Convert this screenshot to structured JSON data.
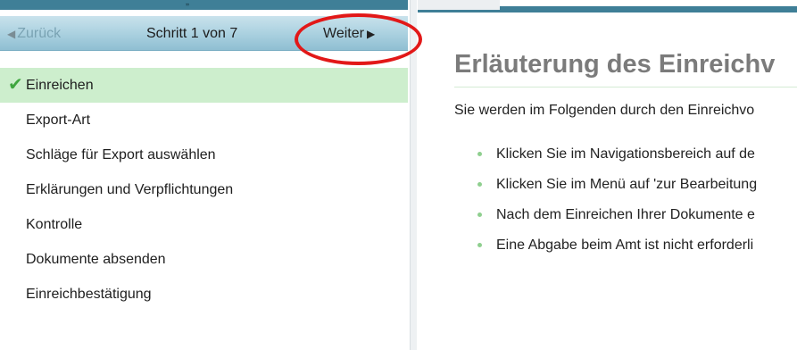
{
  "header": {
    "cut_text": "„"
  },
  "wizard": {
    "back_label": "Zurück",
    "back_icon": "triangle-left-icon",
    "step_text": "Schritt 1 von 7",
    "next_label": "Weiter",
    "next_icon": "triangle-right-icon",
    "highlight_color": "#e21818"
  },
  "steps": [
    {
      "label": "Einreichen",
      "active": true,
      "icon": "checkmark-icon"
    },
    {
      "label": "Export-Art",
      "active": false
    },
    {
      "label": "Schläge für Export auswählen",
      "active": false
    },
    {
      "label": "Erklärungen und Verpflichtungen",
      "active": false
    },
    {
      "label": "Kontrolle",
      "active": false
    },
    {
      "label": "Dokumente absenden",
      "active": false
    },
    {
      "label": "Einreichbestätigung",
      "active": false
    }
  ],
  "content": {
    "title": "Erläuterung des Einreichv",
    "intro": "Sie werden im Folgenden durch den Einreichvo",
    "bullets": [
      "Klicken Sie im Navigationsbereich auf de",
      "Klicken Sie im Menü auf 'zur Bearbeitung",
      "Nach dem Einreichen Ihrer Dokumente e",
      "Eine Abgabe beim Amt ist nicht erforderli"
    ]
  },
  "colors": {
    "header_bar": "#3f7f97",
    "active_step": "#cdeecd",
    "check": "#3fa63f",
    "title": "#7b7b7b"
  }
}
